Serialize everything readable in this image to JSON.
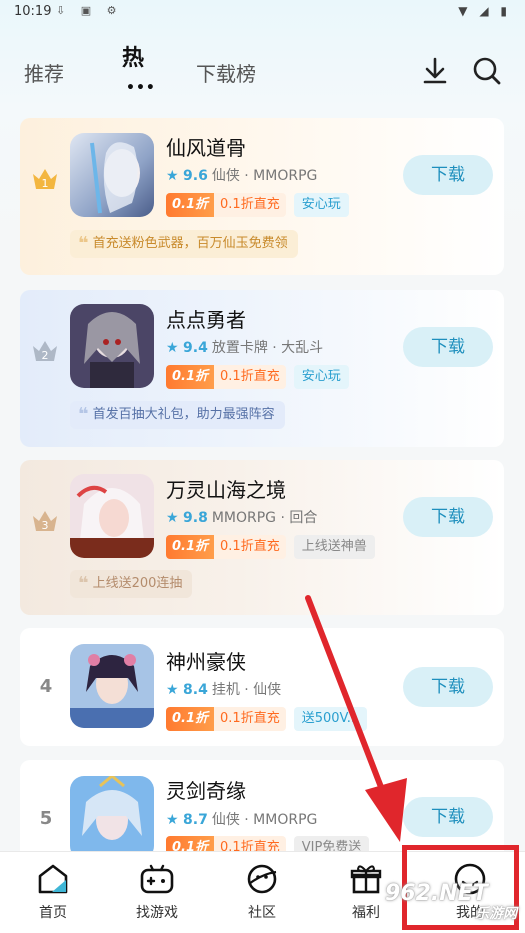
{
  "status_bar": {
    "time": "10:19",
    "left_icons": "⇩ ▣ ⚙",
    "right_icons": "▼ ◢ ▮"
  },
  "tabs": [
    {
      "label": "推荐",
      "active": false
    },
    {
      "label": "热",
      "active": true,
      "indicator": "•••"
    },
    {
      "label": "下载榜",
      "active": false
    }
  ],
  "games": [
    {
      "rank": "1",
      "title": "仙风道骨",
      "score": "9.6",
      "meta": "仙侠 · MMORPG",
      "discount": "0.1折",
      "discount_text": "0.1折直充",
      "tag": "安心玩",
      "tag_style": "blue",
      "quote": "首充送粉色武器，百万仙玉免费领",
      "quote_style": "gold",
      "button": "下载"
    },
    {
      "rank": "2",
      "title": "点点勇者",
      "score": "9.4",
      "meta": "放置卡牌 · 大乱斗",
      "discount": "0.1折",
      "discount_text": "0.1折直充",
      "tag": "安心玩",
      "tag_style": "blue",
      "quote": "首发百抽大礼包，助力最强阵容",
      "quote_style": "blue",
      "button": "下载"
    },
    {
      "rank": "3",
      "title": "万灵山海之境",
      "score": "9.8",
      "meta": "MMORPG · 回合",
      "discount": "0.1折",
      "discount_text": "0.1折直充",
      "tag": "上线送神兽",
      "tag_style": "grey",
      "quote": "上线送200连抽",
      "quote_style": "tan",
      "button": "下载"
    },
    {
      "rank": "4",
      "title": "神州豪侠",
      "score": "8.4",
      "meta": "挂机 · 仙侠",
      "discount": "0.1折",
      "discount_text": "0.1折直充",
      "tag": "送500V...",
      "tag_style": "blue",
      "button": "下载"
    },
    {
      "rank": "5",
      "title": "灵剑奇缘",
      "score": "8.7",
      "meta": "仙侠 · MMORPG",
      "discount": "0.1折",
      "discount_text": "0.1折直充",
      "tag": "VIP免费送",
      "tag_style": "grey",
      "button": "下载"
    }
  ],
  "bottom_nav": [
    {
      "label": "首页",
      "icon": "home-icon"
    },
    {
      "label": "找游戏",
      "icon": "gamepad-icon"
    },
    {
      "label": "社区",
      "icon": "planet-icon"
    },
    {
      "label": "福利",
      "icon": "gift-icon"
    },
    {
      "label": "我的",
      "icon": "smile-icon"
    }
  ],
  "watermark": {
    "brand": "962.NET",
    "sub": "乐游网"
  },
  "colors": {
    "accent": "#1e8fbd",
    "discount": "#ff7a30",
    "annotation": "#e0262c"
  }
}
